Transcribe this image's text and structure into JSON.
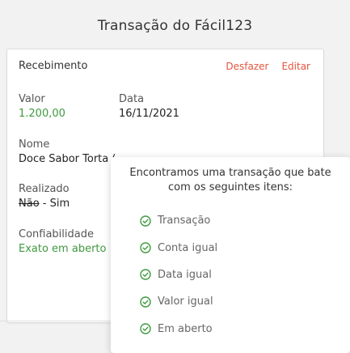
{
  "page": {
    "title": "Transação do Fácil123"
  },
  "card": {
    "header": "Recebimento",
    "actions": {
      "undo": "Desfazer",
      "edit": "Editar"
    },
    "valor": {
      "label": "Valor",
      "value": "1.200,00"
    },
    "data": {
      "label": "Data",
      "value": "16/11/2021"
    },
    "nome": {
      "label": "Nome",
      "value": "Doce Sabor Torta ("
    },
    "realizado": {
      "label": "Realizado",
      "value_struck": "Não",
      "value_rest": " - Sim"
    },
    "confiabilidade": {
      "label": "Confiabilidade",
      "value": "Exato em aberto"
    }
  },
  "popover": {
    "title": "Encontramos uma transação que bate com os seguintes itens:",
    "items": [
      {
        "label": "Transação",
        "icon": "check-circle-icon"
      },
      {
        "label": "Conta igual",
        "icon": "check-circle-icon"
      },
      {
        "label": "Data igual",
        "icon": "check-circle-icon"
      },
      {
        "label": "Valor igual",
        "icon": "check-circle-icon"
      },
      {
        "label": "Em aberto",
        "icon": "check-circle-icon"
      }
    ]
  },
  "colors": {
    "accent_red": "#e4543d",
    "success_green": "#3f9a3f"
  }
}
